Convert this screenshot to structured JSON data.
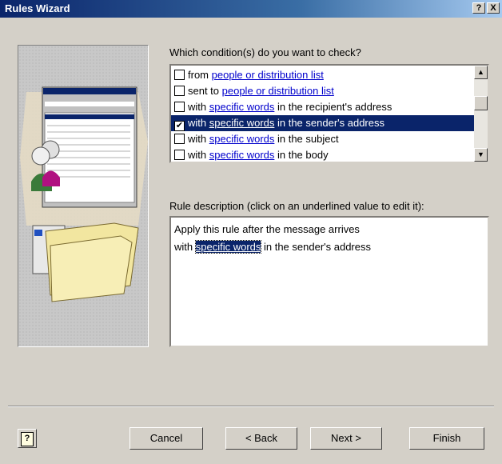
{
  "window": {
    "title": "Rules Wizard",
    "help_glyph": "?",
    "close_glyph": "X"
  },
  "conditions": {
    "prompt": "Which condition(s) do you want to check?",
    "items": [
      {
        "pre": "from ",
        "link": "people or distribution list",
        "post": "",
        "checked": false,
        "selected": false
      },
      {
        "pre": "sent to ",
        "link": "people or distribution list",
        "post": "",
        "checked": false,
        "selected": false
      },
      {
        "pre": "with ",
        "link": "specific words",
        "post": " in the recipient's address",
        "checked": false,
        "selected": false
      },
      {
        "pre": "with ",
        "link": "specific words",
        "post": " in the sender's address",
        "checked": true,
        "selected": true
      },
      {
        "pre": "with ",
        "link": "specific words",
        "post": " in the subject",
        "checked": false,
        "selected": false
      },
      {
        "pre": "with ",
        "link": "specific words",
        "post": " in the body",
        "checked": false,
        "selected": false
      }
    ]
  },
  "description": {
    "label": "Rule description (click on an underlined value to edit it):",
    "line1": "Apply this rule after the message arrives",
    "line2_pre": "with ",
    "line2_link": "specific words",
    "line2_post": " in the sender's address"
  },
  "buttons": {
    "help": "?",
    "cancel": "Cancel",
    "back": "< Back",
    "next": "Next >",
    "finish": "Finish"
  },
  "check_glyph": "✔",
  "scroll": {
    "up": "▲",
    "down": "▼"
  }
}
